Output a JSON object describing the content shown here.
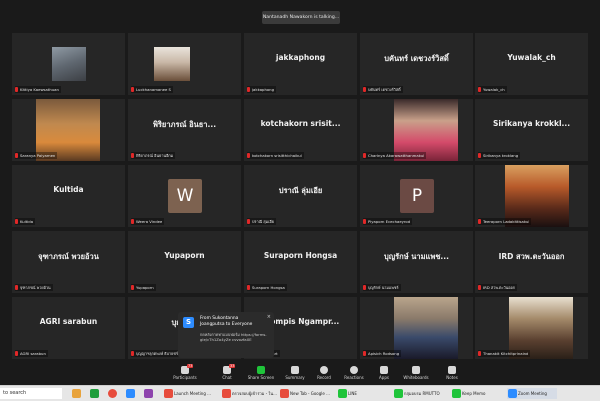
{
  "talking_banner": "Nantanadh Nawakorn is talking...",
  "tiles": [
    {
      "name": "",
      "label": "Kittiya Kaewsathuan"
    },
    {
      "name": "",
      "label": "Luckhanamanee S"
    },
    {
      "name": "jakkaphong",
      "label": "jakkaphong"
    },
    {
      "name": "บคันทร์ เดชวงร์วิสดิ์",
      "label": "บคันทร์ เดชวงร์วิสดิ์"
    },
    {
      "name": "Yuwalak_ch",
      "label": "Yuwalak_ch"
    },
    {
      "name": "",
      "label": "Saranya Paiyamen"
    },
    {
      "name": "พิริยาภรณ์ อินธา...",
      "label": "พิริยาภรณ์ อินธานอีกม"
    },
    {
      "name": "kotchakorn srisit...",
      "label": "kotchakorn srisitthichaikul"
    },
    {
      "name": "",
      "label": "Charinya Akarawatthanmakul"
    },
    {
      "name": "Sirikanya krokkl...",
      "label": "Sirikanya kroklang"
    },
    {
      "name": "Kultida",
      "label": "Kultida"
    },
    {
      "name": "",
      "avatar": "W",
      "label": "Weera Vindee"
    },
    {
      "name": "ปราณี ลุ่มเอีย",
      "label": "ปราณี ลุ่มเอีย"
    },
    {
      "name": "",
      "avatar": "P",
      "label": "Piyaporn Ecechaeyrod"
    },
    {
      "name": "",
      "label": "Teeraporn Ladakittisakul"
    },
    {
      "name": "จุฑาภรณ์ พวยอ้วน",
      "label": "จุฑาภรณ์ พวยอ้วน"
    },
    {
      "name": "Yupaporn",
      "label": "Yupaporn"
    },
    {
      "name": "Suraporn Hongsa",
      "label": "Suraporn Hongsa"
    },
    {
      "name": "บุญรักษ์ นามแพช...",
      "label": "บุญรักษ์ นามแพชร์"
    },
    {
      "name": "IRD สวพ.ตะวันออก",
      "label": "IRD สวพ.ตะวันออก"
    },
    {
      "name": "AGRI sarabun",
      "label": "AGRI sarabun"
    },
    {
      "name": "บุญญาฯ",
      "label": "บุญญาฯลุกตพงษ์ ธิบายชร์"
    },
    {
      "name": "...ompis Ngampr...",
      "label": "...ampraseart"
    },
    {
      "name": "",
      "label": "Apisich Rodsong"
    },
    {
      "name": "",
      "label": "Thanakit Kitchitprinaind"
    }
  ],
  "chat_popup": {
    "from": "From Sukontanna Joangputsa to Everyone",
    "message": "กดหลังกาดทาแบบฟอร์ม https://forms.gle/cTh1Zo4yZe cvvozfaXE"
  },
  "toolbar": {
    "participants": "Participants",
    "participants_count": "73",
    "chat": "Chat",
    "chat_count": "33",
    "share": "Share Screen",
    "summary": "Summary",
    "record": "Record",
    "reactions": "Reactions",
    "apps": "Apps",
    "whiteboards": "Whiteboards",
    "notes": "Notes"
  },
  "taskbar": {
    "search": "to search",
    "items": [
      "Launch Meeting ...",
      "ตรวจสอบผู้เข้าร่วม - ใน...",
      "New Tab - Google ...",
      "LINE",
      "กลุ่มอบรม RMUTTO",
      "Keep Memo",
      "Zoom Meeting"
    ]
  },
  "colors": {
    "accent": "#2d8cff",
    "mic_muted": "#e02828",
    "share_green": "#1fc43a"
  }
}
